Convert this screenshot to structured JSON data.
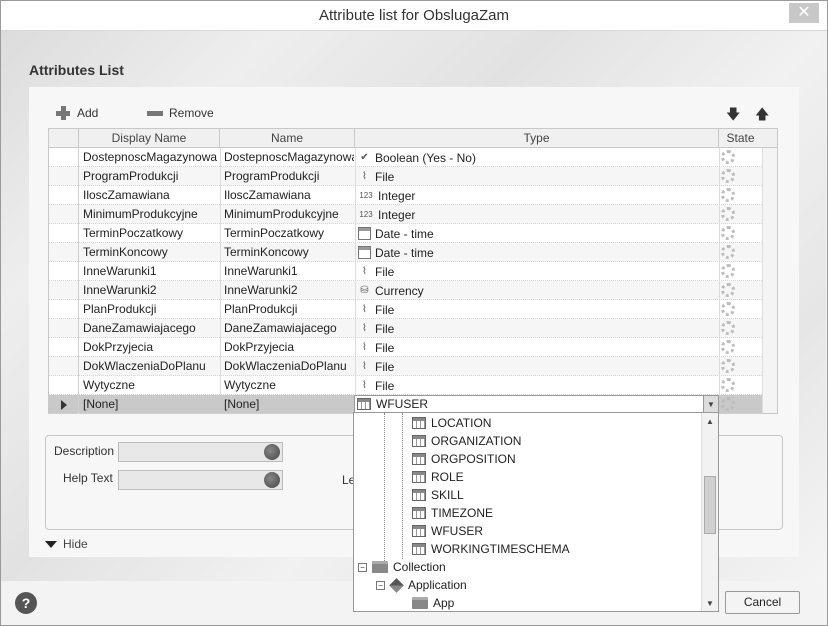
{
  "window": {
    "title": "Attribute list for ObslugaZam",
    "close_label": "✕"
  },
  "section_title": "Attributes List",
  "toolbar": {
    "add_label": "Add",
    "remove_label": "Remove",
    "move_down": "🡇",
    "move_up": "🡅"
  },
  "grid": {
    "columns": [
      "Display Name",
      "Name",
      "Type",
      "State"
    ],
    "rows": [
      {
        "display_name": "DostepnoscMagazynowa",
        "name": "DostepnoscMagazynowa",
        "type": "Boolean (Yes - No)",
        "icon": "check-icon"
      },
      {
        "display_name": "ProgramProdukcji",
        "name": "ProgramProdukcji",
        "type": "File",
        "icon": "paperclip-icon"
      },
      {
        "display_name": "IloscZamawiana",
        "name": "IloscZamawiana",
        "type": "Integer",
        "icon": "number-icon"
      },
      {
        "display_name": "MinimumProdukcyjne",
        "name": "MinimumProdukcyjne",
        "type": "Integer",
        "icon": "number-icon"
      },
      {
        "display_name": "TerminPoczatkowy",
        "name": "TerminPoczatkowy",
        "type": "Date - time",
        "icon": "calendar-icon"
      },
      {
        "display_name": "TerminKoncowy",
        "name": "TerminKoncowy",
        "type": "Date - time",
        "icon": "calendar-icon"
      },
      {
        "display_name": "InneWarunki1",
        "name": "InneWarunki1",
        "type": "File",
        "icon": "paperclip-icon"
      },
      {
        "display_name": "InneWarunki2",
        "name": "InneWarunki2",
        "type": "Currency",
        "icon": "coins-icon"
      },
      {
        "display_name": "PlanProdukcji",
        "name": "PlanProdukcji",
        "type": "File",
        "icon": "paperclip-icon"
      },
      {
        "display_name": "DaneZamawiajacego",
        "name": "DaneZamawiajacego",
        "type": "File",
        "icon": "paperclip-icon"
      },
      {
        "display_name": "DokPrzyjecia",
        "name": "DokPrzyjecia",
        "type": "File",
        "icon": "paperclip-icon"
      },
      {
        "display_name": "DokWlaczeniaDoPlanu",
        "name": "DokWlaczeniaDoPlanu",
        "type": "File",
        "icon": "paperclip-icon"
      },
      {
        "display_name": "Wytyczne",
        "name": "Wytyczne",
        "type": "File",
        "icon": "paperclip-icon"
      }
    ],
    "new_row": {
      "display_name": "[None]",
      "name": "[None]",
      "type": "WFUSER"
    }
  },
  "type_icons": {
    "check": "✔",
    "paperclip": "⌇",
    "number": "123",
    "coins": "⛁"
  },
  "dropdown": {
    "items": [
      "LOCATION",
      "ORGANIZATION",
      "ORGPOSITION",
      "ROLE",
      "SKILL",
      "TIMEZONE",
      "WFUSER",
      "WORKINGTIMESCHEMA"
    ],
    "collection_label": "Collection",
    "application_label": "Application",
    "app_label": "App",
    "expander_symbol": "−"
  },
  "details": {
    "description_label": "Description",
    "help_text_label": "Help Text",
    "partial_label": "Le",
    "hide_label": "Hide"
  },
  "footer": {
    "help_label": "?",
    "cancel_label": "Cancel"
  }
}
